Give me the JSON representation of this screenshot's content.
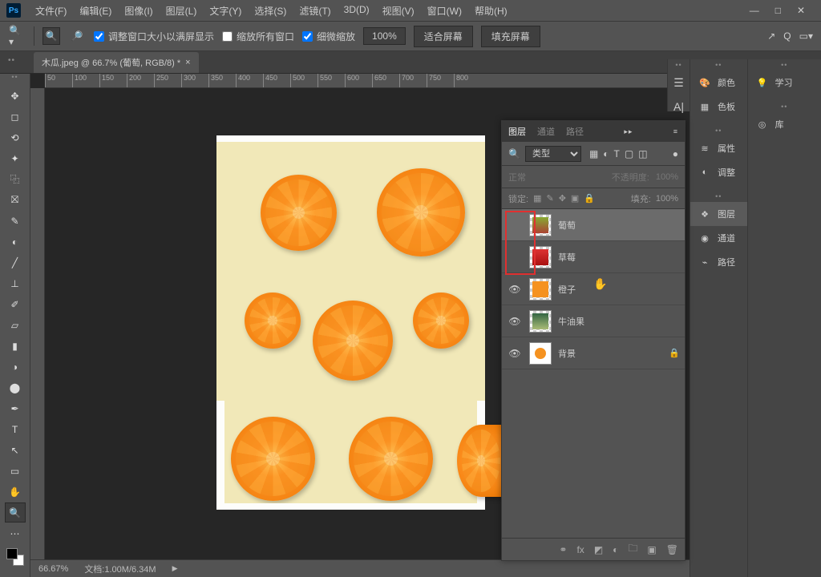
{
  "menu": [
    "文件(F)",
    "编辑(E)",
    "图像(I)",
    "图层(L)",
    "文字(Y)",
    "选择(S)",
    "滤镜(T)",
    "3D(D)",
    "视图(V)",
    "窗口(W)",
    "帮助(H)"
  ],
  "options": {
    "fit_window": "调整窗口大小以满屏显示",
    "zoom_all": "缩放所有窗口",
    "scrubby": "细微缩放",
    "zoom_value": "100%",
    "fit_screen": "适合屏幕",
    "fill_screen": "填充屏幕"
  },
  "tab": {
    "title": "木瓜.jpeg @ 66.7% (葡萄, RGB/8) *"
  },
  "ruler": [
    "50",
    "100",
    "150",
    "200",
    "250",
    "300",
    "350",
    "400",
    "450",
    "500",
    "550",
    "600",
    "650",
    "700",
    "750",
    "800"
  ],
  "layers_panel": {
    "tabs": [
      "图层",
      "通道",
      "路径"
    ],
    "filter_label": "类型",
    "blend_mode": "正常",
    "opacity_label": "不透明度:",
    "opacity_value": "100%",
    "lock_label": "锁定:",
    "fill_label": "填充:",
    "fill_value": "100%",
    "layers": [
      {
        "name": "葡萄",
        "visible": false
      },
      {
        "name": "草莓",
        "visible": false
      },
      {
        "name": "橙子",
        "visible": true
      },
      {
        "name": "牛油果",
        "visible": true
      },
      {
        "name": "背景",
        "visible": true,
        "locked": true
      }
    ]
  },
  "right_panels": {
    "col1": [
      "颜色",
      "色板",
      "",
      "属性",
      "调整",
      "",
      "图层",
      "通道",
      "路径"
    ],
    "col2": [
      "学习",
      "",
      "库"
    ]
  },
  "status": {
    "zoom": "66.67%",
    "doc": "文档:1.00M/6.34M"
  }
}
